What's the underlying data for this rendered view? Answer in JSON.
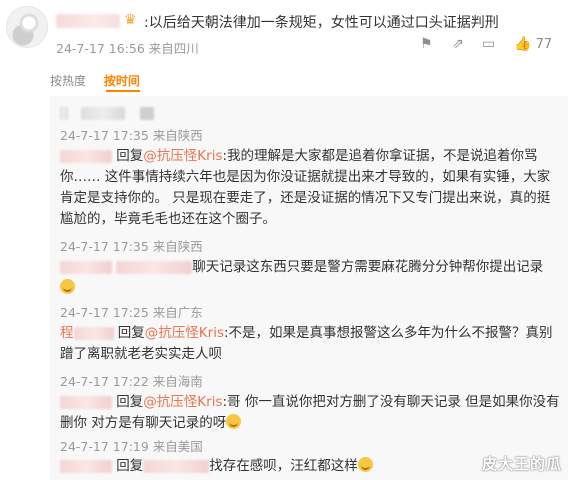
{
  "comment": {
    "text": ":以后给天朝法律加一条规矩，女性可以通过口头证据判刑",
    "time": "24-7-17 16:56",
    "location": "来自四川",
    "likes": "77"
  },
  "sort": {
    "options": [
      "按热度",
      "按时间"
    ],
    "active": "按时间"
  },
  "replies": [
    {
      "prefix": "回复",
      "mention": "@抗压怪Kris",
      "text": ":我的理解是大家都是追着你拿证据，不是说追着你骂你…… 这件事情持续六年也是因为你没证据就提出来才导致的，如果有实锤，大家肯定是支持你的。 只是现在要走了，还是没证据的情况下又专门提出来说，真的挺尴尬的，毕竟毛毛也还在这个圈子。"
    },
    {
      "time": "24-7-17 17:35",
      "location": "来自陕西"
    },
    {
      "text": "聊天记录这东西只要是警方需要麻花腾分分钟帮你提出记录"
    },
    {
      "time": "24-7-17 17:25",
      "location": "来自广东"
    },
    {
      "user": "程",
      "prefix": "回复",
      "mention": "@抗压怪Kris",
      "text": ":不是，如果是真事想报警这么多年为什么不报警？真别蹭了离职就老老实实走人呗"
    },
    {
      "time": "24-7-17 17:22",
      "location": "来自海南"
    },
    {
      "prefix": "回复",
      "mention": "@抗压怪Kris",
      "text": ":哥 你一直说你把对方删了没有聊天记录 但是如果你没有删你 对方是有聊天记录的呀"
    },
    {
      "time": "24-7-17 17:19",
      "location": "来自美国"
    },
    {
      "prefix": "回复",
      "text": "找存在感呗，汪红都这样"
    },
    {
      "time": "24-7-17 17:18",
      "location": "来自重庆"
    }
  ],
  "top_reply_time": "24-7-17 17:35",
  "top_reply_location": "来自陕西",
  "watermark": "皮大王的瓜"
}
